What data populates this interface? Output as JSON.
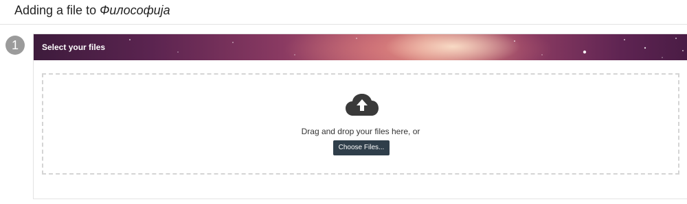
{
  "header": {
    "title_prefix": "Adding a file to",
    "title_name": "Философија"
  },
  "step": {
    "number": "1",
    "title": "Select your files"
  },
  "dropzone": {
    "icon": "cloud-upload-icon",
    "text": "Drag and drop your files here, or",
    "button_label": "Choose Files..."
  },
  "colors": {
    "button_bg": "#2f3e4a",
    "step_circle": "#9b9b9b",
    "banner_purple": "#5b2450",
    "banner_glow": "#c97a78"
  }
}
